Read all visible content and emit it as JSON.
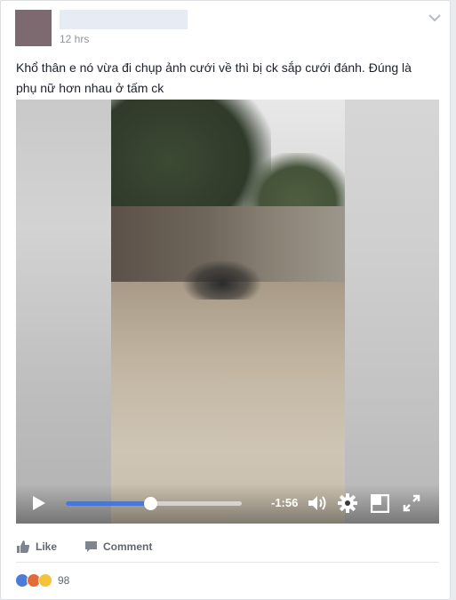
{
  "post": {
    "author_name": "",
    "timestamp": "12 hrs",
    "text": "Khổ thân e nó vừa đi chụp ảnh cưới về thì bị ck sắp cưới đánh. Đúng là phụ nữ hơn nhau ở tấm ck"
  },
  "video": {
    "time_remaining": "-1:56",
    "progress": 0.48,
    "icons": [
      "play-icon",
      "volume-icon",
      "gear-icon",
      "resize-icon",
      "fullscreen-icon"
    ]
  },
  "actions": {
    "like_label": "Like",
    "comment_label": "Comment"
  },
  "reactions": {
    "types": [
      "like",
      "angry",
      "sad"
    ],
    "count": "98"
  },
  "colors": {
    "progress_fill": "#4a76d4",
    "link_gray": "#616770",
    "timestamp_gray": "#90949c"
  }
}
